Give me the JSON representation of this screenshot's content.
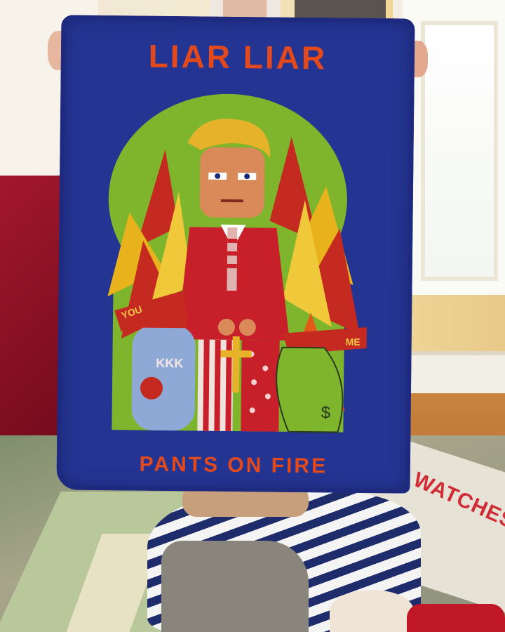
{
  "rug_hanging": {
    "top_text": "LIAR LIAR",
    "bottom_text": "PANTS ON FIRE",
    "jar_text": "KKK",
    "ribbon_left": "YOU",
    "ribbon_right": "ME",
    "money_sign": "$"
  },
  "floor_rug": {
    "text": "WHO WATCHES AN"
  },
  "colors": {
    "background_blue": "#243493",
    "lettering": "#e24a1d",
    "halo_green": "#7fb52c",
    "suit_red": "#c8202a",
    "hair_yellow": "#e6b22a"
  }
}
